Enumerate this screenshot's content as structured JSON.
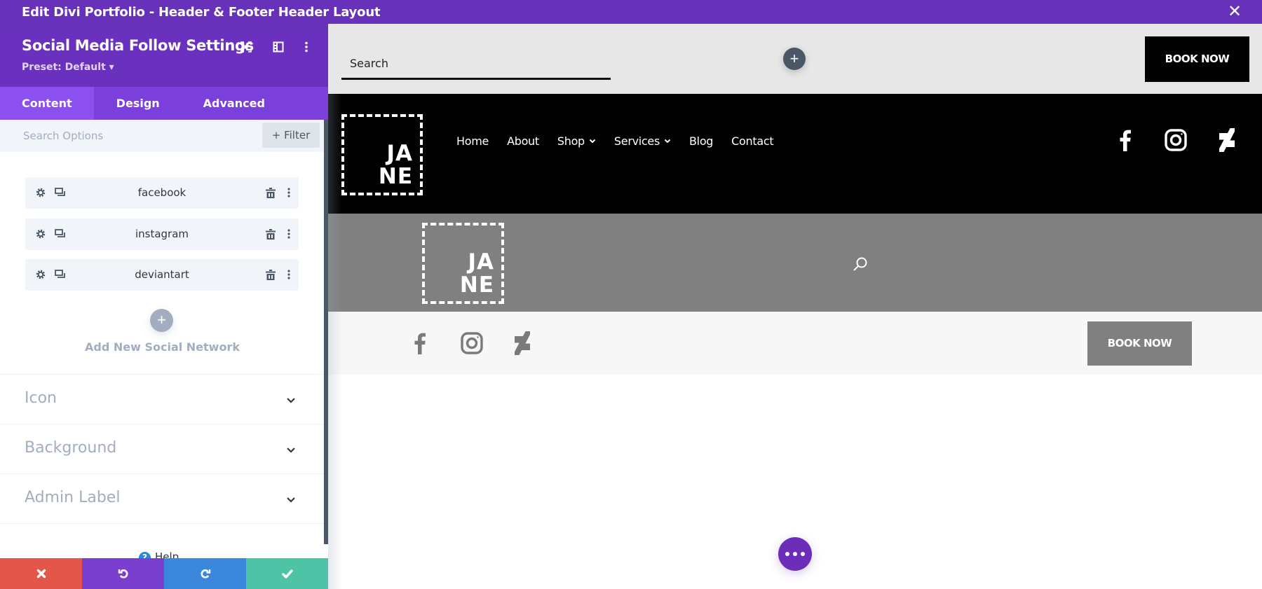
{
  "window": {
    "title": "Edit Divi Portfolio - Header & Footer Header Layout",
    "close_icon": "close-icon"
  },
  "panel": {
    "title": "Social Media Follow Settings",
    "preset": "Preset: Default",
    "header_icons": [
      "expand-icon",
      "split-view-icon",
      "more-vertical-icon"
    ],
    "tabs": [
      {
        "label": "Content",
        "active": true
      },
      {
        "label": "Design",
        "active": false
      },
      {
        "label": "Advanced",
        "active": false
      }
    ],
    "search": {
      "placeholder": "Search Options",
      "value": ""
    },
    "filter_label": "Filter",
    "networks": [
      {
        "label": "facebook"
      },
      {
        "label": "instagram"
      },
      {
        "label": "deviantart"
      }
    ],
    "add_network_label": "Add New Social Network",
    "sections": [
      {
        "label": "Icon"
      },
      {
        "label": "Background"
      },
      {
        "label": "Admin Label"
      }
    ],
    "help_label": "Help",
    "actions": [
      {
        "name": "discard",
        "icon": "close-icon",
        "color": "#e5564a"
      },
      {
        "name": "undo",
        "icon": "undo-icon",
        "color": "#7b3fcf"
      },
      {
        "name": "redo",
        "icon": "redo-icon",
        "color": "#3b87dc"
      },
      {
        "name": "save",
        "icon": "check-icon",
        "color": "#4ec3a5"
      }
    ]
  },
  "preview": {
    "top_strip": {
      "search_placeholder": "Search",
      "book_now": "BOOK NOW"
    },
    "header": {
      "logo_line1": "JA",
      "logo_line2": "NE",
      "nav": [
        {
          "label": "Home",
          "dropdown": false
        },
        {
          "label": "About",
          "dropdown": false
        },
        {
          "label": "Shop",
          "dropdown": true
        },
        {
          "label": "Services",
          "dropdown": true
        },
        {
          "label": "Blog",
          "dropdown": false
        },
        {
          "label": "Contact",
          "dropdown": false
        }
      ],
      "social": [
        "facebook-icon",
        "instagram-icon",
        "deviantart-icon"
      ]
    },
    "gray_row": {
      "logo_line1": "JA",
      "logo_line2": "NE"
    },
    "light_row": {
      "social": [
        "facebook-icon",
        "instagram-icon",
        "deviantart-icon"
      ],
      "book_now": "BOOK NOW"
    }
  },
  "colors": {
    "brand_purple": "#6732b9",
    "tab_bar": "#7b3fdc",
    "active_tab": "#8c50f0"
  }
}
